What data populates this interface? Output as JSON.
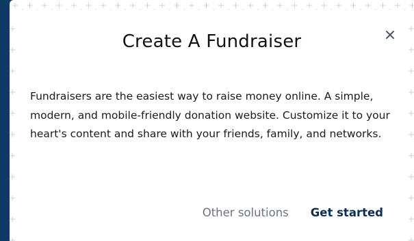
{
  "modal": {
    "title": "Create A Fundraiser",
    "description": "Fundraisers are the easiest way to raise money online. A simple, modern, and mobile-friendly donation website. Customize it to your heart's content and share with your friends, family, and networks.",
    "close_icon": "close-icon",
    "secondary_button_label": "Other solutions",
    "primary_button_label": "Get started"
  },
  "colors": {
    "backdrop": "#0e3a66",
    "modal_background": "#ffffff",
    "primary_button": "#0b2f57",
    "secondary_button": "#6b7280",
    "grid_plus": "#c9d3de"
  }
}
